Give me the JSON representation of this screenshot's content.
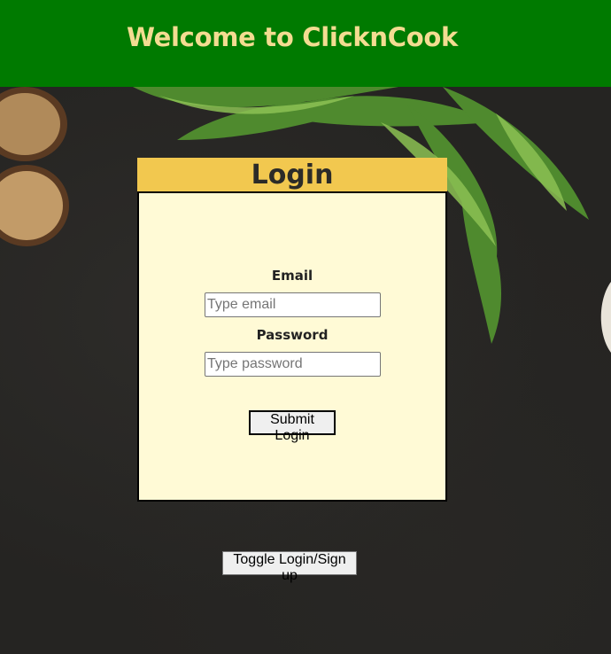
{
  "header": {
    "title": "Welcome to ClicknCook"
  },
  "login": {
    "title": "Login",
    "email_label": "Email",
    "email_placeholder": "Type email",
    "password_label": "Password",
    "password_placeholder": "Type password",
    "submit_label": "Submit Login"
  },
  "toggle_label": "Toggle Login/Sign up",
  "colors": {
    "header_bg": "#007a00",
    "header_text": "#f3dc91",
    "login_title_bg": "#f2c84f",
    "panel_bg": "#fffad6"
  }
}
